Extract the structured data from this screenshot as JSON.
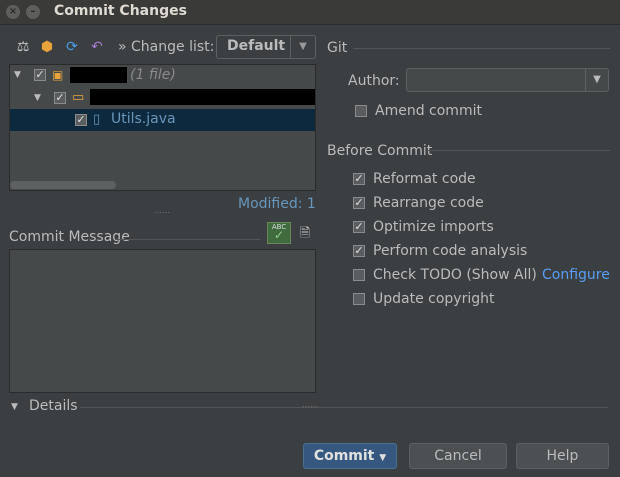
{
  "window": {
    "title": "Commit Changes"
  },
  "toolbar": {
    "changelist_label": "» Change list:",
    "changelist_value": "Default"
  },
  "tree": {
    "root_count": "(1 file)",
    "file_name": "Utils.java"
  },
  "status": {
    "modified": "Modified: 1"
  },
  "commit_message": {
    "label": "Commit Message",
    "value": ""
  },
  "details": {
    "label": "Details"
  },
  "git": {
    "section_label": "Git",
    "author_label": "Author:",
    "author_value": "",
    "amend_label": "Amend commit"
  },
  "before_commit": {
    "section_label": "Before Commit",
    "options": [
      {
        "label": "Reformat code",
        "checked": true
      },
      {
        "label": "Rearrange code",
        "checked": true
      },
      {
        "label": "Optimize imports",
        "checked": true
      },
      {
        "label": "Perform code analysis",
        "checked": true
      },
      {
        "label": "Check TODO (Show All)",
        "checked": false
      },
      {
        "label": "Update copyright",
        "checked": false
      }
    ],
    "configure_link": "Configure"
  },
  "buttons": {
    "commit": "Commit",
    "cancel": "Cancel",
    "help": "Help"
  },
  "colors": {
    "background": "#3c3f41",
    "accent": "#365880",
    "link": "#589df6",
    "selection": "#0d293e"
  }
}
